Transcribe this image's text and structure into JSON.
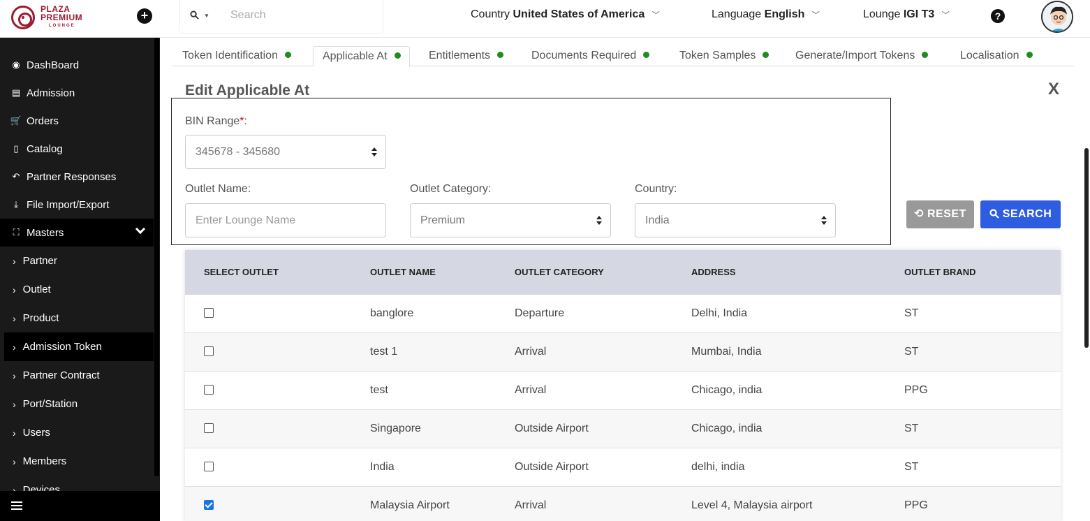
{
  "header": {
    "logo": {
      "line1": "PLAZA",
      "line2": "PREMIUM",
      "line3": "LOUNGE"
    },
    "search_placeholder": "Search",
    "country": {
      "label": "Country",
      "value": "United States of America"
    },
    "language": {
      "label": "Language",
      "value": "English"
    },
    "lounge": {
      "label": "Lounge",
      "value": "IGI T3"
    },
    "help": "?"
  },
  "sidebar": {
    "items": [
      {
        "label": "DashBoard",
        "icon": "dashboard-icon"
      },
      {
        "label": "Admission",
        "icon": "id-card-icon"
      },
      {
        "label": "Orders",
        "icon": "cart-icon"
      },
      {
        "label": "Catalog",
        "icon": "file-icon"
      },
      {
        "label": "Partner Responses",
        "icon": "reply-all-icon"
      },
      {
        "label": "File Import/Export",
        "icon": "download-icon"
      },
      {
        "label": "Masters",
        "icon": "sitemap-icon"
      }
    ],
    "sub_items": [
      {
        "label": "Partner"
      },
      {
        "label": "Outlet"
      },
      {
        "label": "Product"
      },
      {
        "label": "Admission Token"
      },
      {
        "label": "Partner Contract"
      },
      {
        "label": "Port/Station"
      },
      {
        "label": "Users"
      },
      {
        "label": "Members"
      },
      {
        "label": "Devices"
      }
    ]
  },
  "tabs": [
    {
      "label": "Token Identification"
    },
    {
      "label": "Applicable At"
    },
    {
      "label": "Entitlements"
    },
    {
      "label": "Documents Required"
    },
    {
      "label": "Token Samples"
    },
    {
      "label": "Generate/Import Tokens"
    },
    {
      "label": "Localisation"
    }
  ],
  "page": {
    "title": "Edit Applicable At",
    "close": "X"
  },
  "form": {
    "bin_label": "BIN Range",
    "bin_req": "*",
    "bin_colon": ":",
    "bin_value": "345678 - 345680",
    "outlet_name_label": "Outlet Name:",
    "outlet_name_placeholder": "Enter Lounge Name",
    "outlet_category_label": "Outlet Category:",
    "outlet_category_value": "Premium",
    "country_label": "Country:",
    "country_value": "India"
  },
  "buttons": {
    "reset": "RESET",
    "search": "SEARCH"
  },
  "table": {
    "headers": [
      "SELECT OUTLET",
      "OUTLET NAME",
      "OUTLET CATEGORY",
      "ADDRESS",
      "OUTLET BRAND"
    ],
    "rows": [
      {
        "checked": false,
        "name": "banglore",
        "category": "Departure",
        "address": "Delhi, India",
        "brand": "ST"
      },
      {
        "checked": false,
        "name": "test 1",
        "category": "Arrival",
        "address": "Mumbai, India",
        "brand": "ST"
      },
      {
        "checked": false,
        "name": "test",
        "category": "Arrival",
        "address": "Chicago, india",
        "brand": "PPG"
      },
      {
        "checked": false,
        "name": "Singapore",
        "category": "Outside Airport",
        "address": "Chicago, india",
        "brand": "ST"
      },
      {
        "checked": false,
        "name": "India",
        "category": "Outside Airport",
        "address": "delhi, india",
        "brand": "ST"
      },
      {
        "checked": true,
        "name": "Malaysia Airport",
        "category": "Arrival",
        "address": "Level 4, Malaysia airport",
        "brand": "PPG"
      }
    ]
  },
  "colors": {
    "brand": "#9b1b30",
    "primary_button": "#2f5de0",
    "reset_button": "#999999",
    "status_dot": "#1e8c1e",
    "table_header": "#d5d8e2"
  }
}
